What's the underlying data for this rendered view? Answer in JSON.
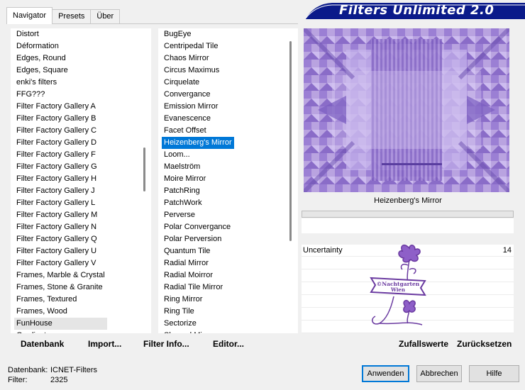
{
  "tabs": [
    {
      "label": "Navigator",
      "active": true
    },
    {
      "label": "Presets",
      "active": false
    },
    {
      "label": "Über",
      "active": false
    }
  ],
  "app_title": "Filters Unlimited 2.0",
  "categories": {
    "items": [
      "Distort",
      "Déformation",
      "Edges, Round",
      "Edges, Square",
      "enki's filters",
      "FFG???",
      "Filter Factory Gallery A",
      "Filter Factory Gallery B",
      "Filter Factory Gallery C",
      "Filter Factory Gallery D",
      "Filter Factory Gallery F",
      "Filter Factory Gallery G",
      "Filter Factory Gallery H",
      "Filter Factory Gallery J",
      "Filter Factory Gallery L",
      "Filter Factory Gallery M",
      "Filter Factory Gallery N",
      "Filter Factory Gallery Q",
      "Filter Factory Gallery U",
      "Filter Factory Gallery V",
      "Frames, Marble & Crystal",
      "Frames, Stone & Granite",
      "Frames, Textured",
      "Frames, Wood",
      "FunHouse",
      "Gradient"
    ],
    "selected": "FunHouse"
  },
  "filters": {
    "items": [
      "BugEye",
      "Centripedal Tile",
      "Chaos Mirror",
      "Circus Maximus",
      "Cirquelate",
      "Convergance",
      "Emission Mirror",
      "Evanescence",
      "Facet Offset",
      "Heizenberg's Mirror",
      "Loom...",
      "Maelström",
      "Moire Mirror",
      "PatchRing",
      "PatchWork",
      "Perverse",
      "Polar Convergance",
      "Polar Perversion",
      "Quantum Tile",
      "Radial Mirror",
      "Radial Moirror",
      "Radial Tile Mirror",
      "Ring Mirror",
      "Ring Tile",
      "Sectorize",
      "Skewed Mirror"
    ],
    "selected": "Heizenberg's Mirror"
  },
  "preview": {
    "filter_name": "Heizenberg's Mirror",
    "tint": "#b9a3e0"
  },
  "params": [
    {
      "label": "Uncertainty",
      "value": "14"
    }
  ],
  "watermark": {
    "line1": "©Nachtgarten",
    "line2": "Wien"
  },
  "toolbar": {
    "database": "Datenbank",
    "import": "Import...",
    "filter_info": "Filter Info...",
    "editor": "Editor...",
    "randomize": "Zufallswerte",
    "reset": "Zurücksetzen"
  },
  "status": {
    "db_label": "Datenbank:",
    "db_value": "ICNET-Filters",
    "filter_label": "Filter:",
    "filter_value": "2325"
  },
  "buttons": {
    "apply": "Anwenden",
    "cancel": "Abbrechen",
    "help": "Hilfe"
  },
  "colors": {
    "banner": "#0a1a8a",
    "selection": "#0078d7",
    "preview_purple": "#9b7fd4",
    "watermark": "#6a3aa0"
  }
}
